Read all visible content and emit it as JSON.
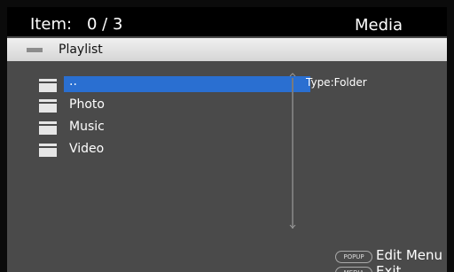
{
  "header": {
    "item_label": "Item:",
    "item_count": "0 / 3",
    "title": "Media"
  },
  "path_bar": {
    "icon": "folder-flat-icon",
    "label": "Playlist"
  },
  "list": {
    "items": [
      {
        "label": "..",
        "icon": "folder-icon",
        "selected": true
      },
      {
        "label": "Photo",
        "icon": "folder-icon",
        "selected": false
      },
      {
        "label": "Music",
        "icon": "folder-icon",
        "selected": false
      },
      {
        "label": "Video",
        "icon": "folder-icon",
        "selected": false
      }
    ]
  },
  "info": {
    "type_text": "Type:Folder"
  },
  "hints": [
    {
      "key": "POPUP",
      "action": "Edit Menu"
    },
    {
      "key": "MEDIA",
      "action": "Exit"
    }
  ],
  "colors": {
    "panel_bg": "#4a4a4a",
    "header_bg": "#000000",
    "selection": "#2a6fd1",
    "text": "#ffffff"
  }
}
